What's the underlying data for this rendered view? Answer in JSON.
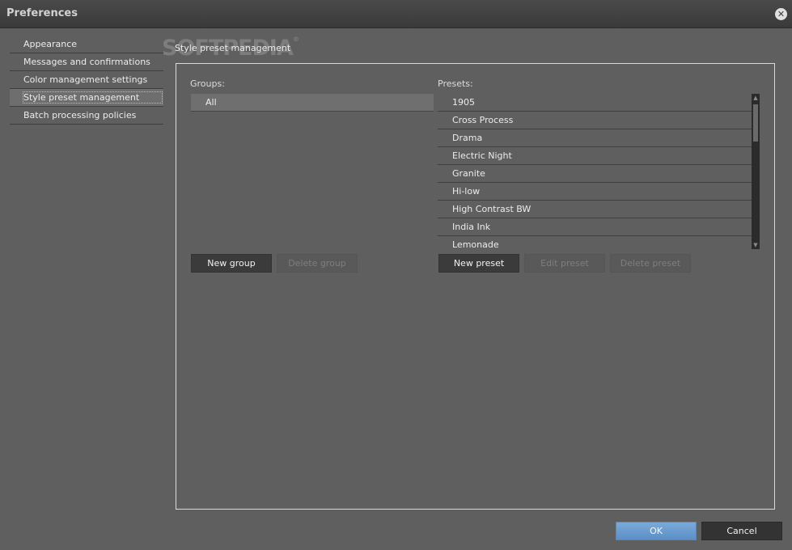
{
  "window": {
    "title": "Preferences",
    "close_icon": "close-icon"
  },
  "nav": {
    "items": [
      {
        "label": "Appearance"
      },
      {
        "label": "Messages and confirmations"
      },
      {
        "label": "Color management settings"
      },
      {
        "label": "Style preset management",
        "selected": true
      },
      {
        "label": "Batch processing policies"
      }
    ]
  },
  "watermark": {
    "text": "SOFTPEDIA",
    "mark": "®"
  },
  "section": {
    "title": "Style preset management"
  },
  "groups": {
    "label": "Groups:",
    "items": [
      {
        "label": "All",
        "selected": true
      }
    ],
    "new_button": "New group",
    "delete_button": "Delete group"
  },
  "presets": {
    "label": "Presets:",
    "items": [
      {
        "label": "1905"
      },
      {
        "label": "Cross Process"
      },
      {
        "label": "Drama"
      },
      {
        "label": "Electric Night"
      },
      {
        "label": "Granite"
      },
      {
        "label": "Hi-low"
      },
      {
        "label": "High Contrast BW"
      },
      {
        "label": "India Ink"
      },
      {
        "label": "Lemonade"
      }
    ],
    "new_button": "New preset",
    "edit_button": "Edit preset",
    "delete_button": "Delete preset"
  },
  "footer": {
    "ok_label": "OK",
    "cancel_label": "Cancel"
  },
  "colors": {
    "accent": "#6a9bd0",
    "background": "#5f5f5f"
  }
}
